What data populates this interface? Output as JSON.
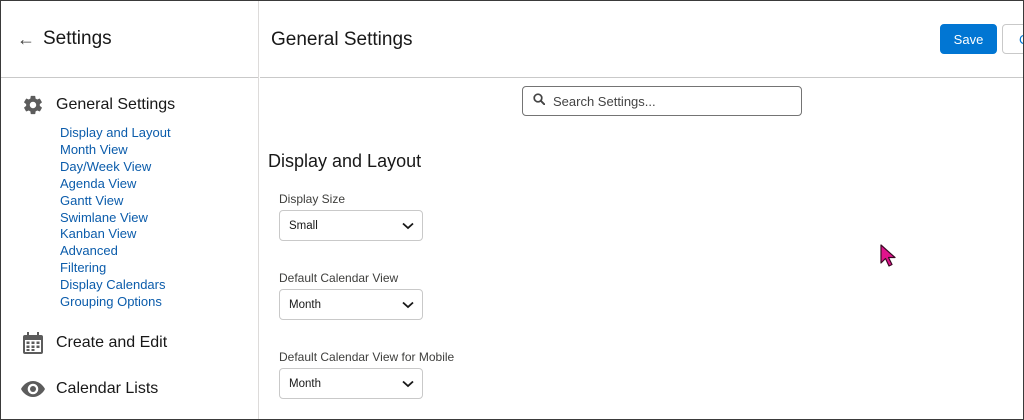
{
  "sidebar": {
    "title": "Settings",
    "sections": {
      "general": {
        "label": "General Settings",
        "icon": "gear-icon"
      },
      "create_edit": {
        "label": "Create and Edit",
        "icon": "calendar-icon"
      },
      "calendar_lists": {
        "label": "Calendar Lists",
        "icon": "eye-icon"
      }
    },
    "sublinks": [
      "Display and Layout",
      "Month View",
      "Day/Week View",
      "Agenda View",
      "Gantt View",
      "Swimlane View",
      "Kanban View",
      "Advanced",
      "Filtering",
      "Display Calendars",
      "Grouping Options"
    ]
  },
  "header": {
    "title": "General Settings",
    "save_label": "Save",
    "cancel_label": "C"
  },
  "search": {
    "placeholder": "Search Settings..."
  },
  "content": {
    "section_title": "Display and Layout",
    "fields": {
      "display_size": {
        "label": "Display Size",
        "value": "Small"
      },
      "default_view": {
        "label": "Default Calendar View",
        "value": "Month"
      },
      "default_view_mobile": {
        "label": "Default Calendar View for Mobile",
        "value": "Month"
      }
    }
  },
  "colors": {
    "brand": "#0176d3",
    "link": "#0b5cab",
    "cursor": "#e0138c"
  }
}
